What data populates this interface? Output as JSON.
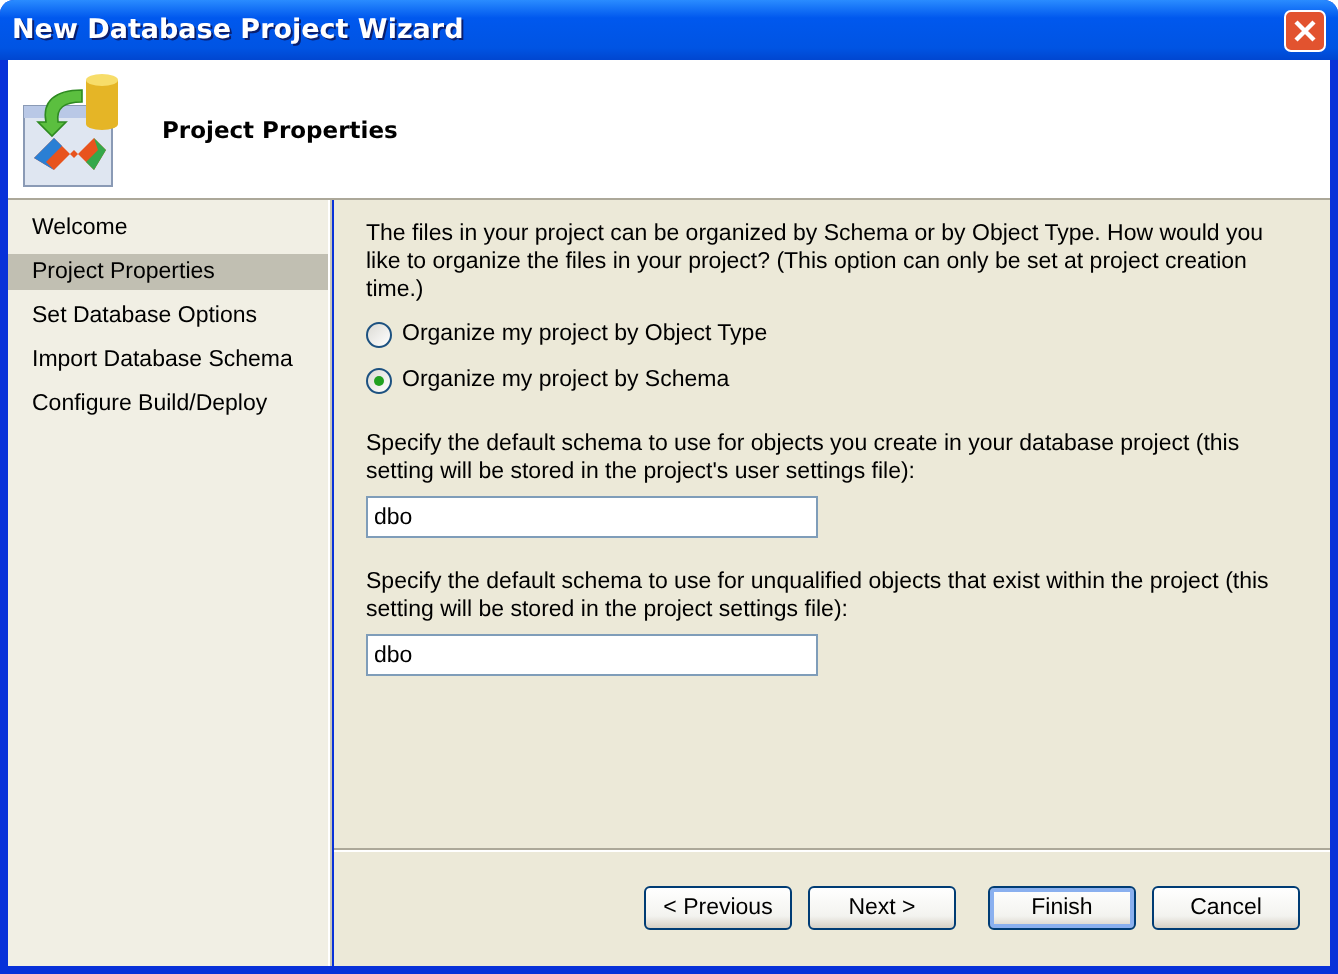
{
  "window": {
    "title": "New Database Project Wizard"
  },
  "header": {
    "title": "Project Properties"
  },
  "sidebar": {
    "items": [
      {
        "label": "Welcome",
        "selected": false
      },
      {
        "label": "Project Properties",
        "selected": true
      },
      {
        "label": "Set Database Options",
        "selected": false
      },
      {
        "label": "Import Database Schema",
        "selected": false
      },
      {
        "label": "Configure Build/Deploy",
        "selected": false
      }
    ]
  },
  "intro": "The files in your project can be organized by Schema or by Object Type. How would you like to organize the files in your project? (This option can only be set at project creation time.)",
  "options": [
    {
      "label": "Organize my project by Object Type",
      "selected": false
    },
    {
      "label": "Organize my project by Schema",
      "selected": true
    }
  ],
  "fields": [
    {
      "label": "Specify the default schema to use for objects you create in your database project (this setting will be stored in the project's user settings file):",
      "value": "dbo"
    },
    {
      "label": "Specify the default schema to use for unqualified objects that exist within the project (this setting will be stored in the project settings file):",
      "value": "dbo"
    }
  ],
  "buttons": [
    {
      "label": "< Previous",
      "default": false
    },
    {
      "label": "Next >",
      "default": false
    },
    {
      "label": "Finish",
      "default": true
    },
    {
      "label": "Cancel",
      "default": false
    }
  ]
}
